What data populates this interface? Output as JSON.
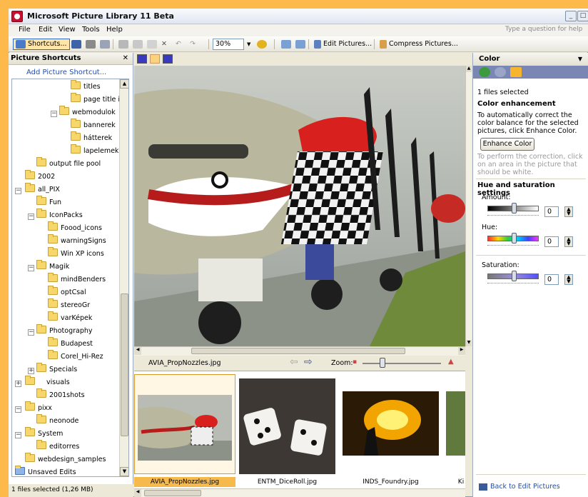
{
  "window": {
    "title": "Microsoft Picture Library 11 Beta",
    "help_placeholder": "Type a question for help"
  },
  "menu": [
    "File",
    "Edit",
    "View",
    "Tools",
    "Help"
  ],
  "toolbar": {
    "shortcuts": "Shortcuts...",
    "zoom": "30%",
    "edit_pictures": "Edit Pictures...",
    "compress_pictures": "Compress Pictures..."
  },
  "left": {
    "header": "Picture Shortcuts",
    "add_link": "Add Picture Shortcut...",
    "tree": [
      "titles",
      "page title imag",
      "webmodulok",
      "bannerek",
      "hátterek",
      "lapelemek",
      "output file pool",
      "2002",
      "all_PIX",
      "Fun",
      "IconPacks",
      "Foood_icons",
      "warningSigns",
      "Win XP icons",
      "Magik",
      "mindBenders",
      "optCsal",
      "stereoGr",
      "varKépek",
      "Photography",
      "Budapest",
      "Corel_Hi-Rez",
      "Specials",
      "visuals",
      "2001shots",
      "pixx",
      "neonode",
      "System",
      "editorres",
      "webdesign_samples",
      "Unsaved Edits"
    ],
    "status": "1 files selected (1,26 MB)"
  },
  "center": {
    "filename": "AVIA_PropNozzles.jpg",
    "zoom_label": "Zoom:",
    "thumbs": [
      "AVIA_PropNozzles.jpg",
      "ENTM_DiceRoll.jpg",
      "INDS_Foundry.jpg",
      "Ki"
    ]
  },
  "right": {
    "header": "Color",
    "files_selected": "1 files selected",
    "enh_title": "Color enhancement",
    "enh_desc": "To automatically correct the color balance for the selected pictures, click Enhance Color.",
    "enhance_button": "Enhance Color",
    "enh_hint": "To perform the correction, click on an area in the picture that should be white.",
    "hs_title": "Hue and saturation settings",
    "amount_label": "Amount:",
    "hue_label": "Hue:",
    "saturation_label": "Saturation:",
    "amount_value": "0",
    "hue_value": "0",
    "saturation_value": "0",
    "back_link": "Back to Edit Pictures"
  }
}
